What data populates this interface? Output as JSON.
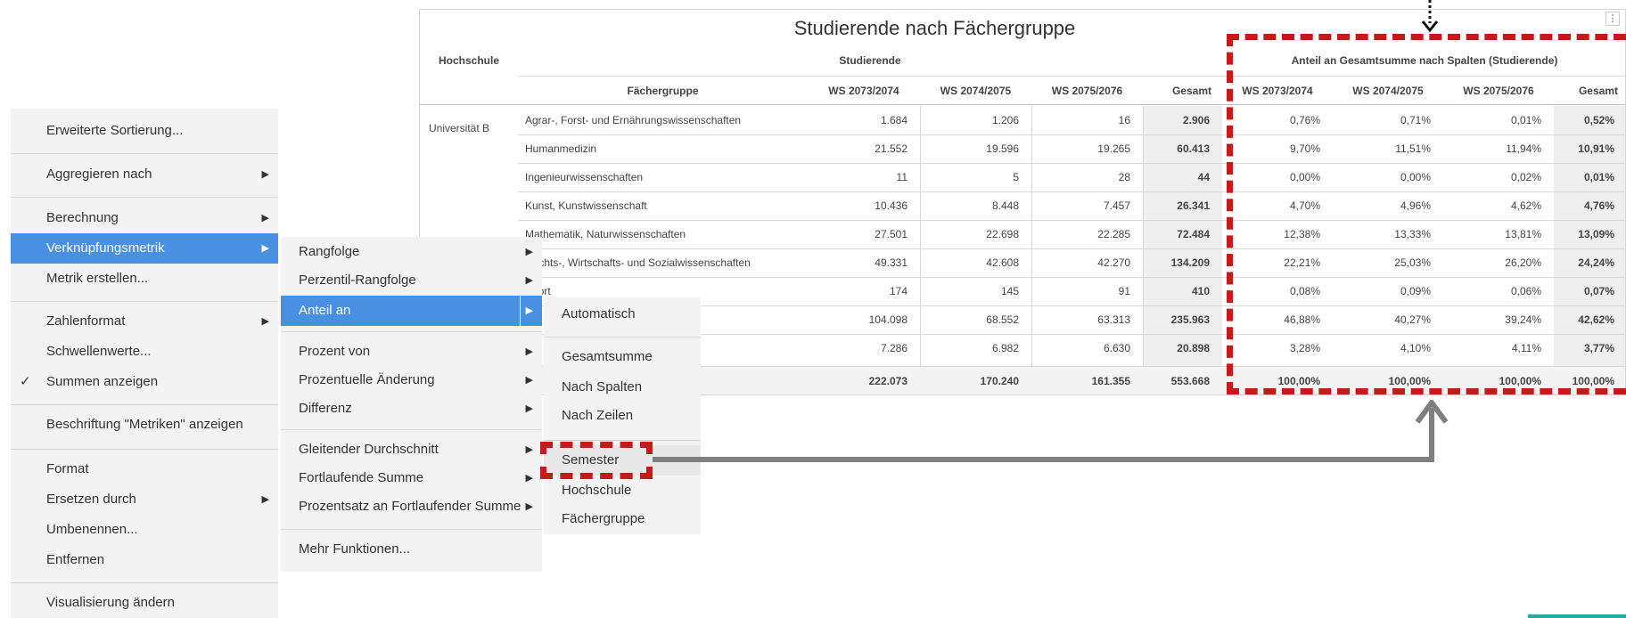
{
  "grid": {
    "title": "Studierende nach Fächergruppe",
    "more_glyph": "⋮",
    "headers": {
      "hochschule": "Hochschule",
      "studierende": "Studierende",
      "anteil": "Anteil an Gesamtsumme nach Spalten (Studierende)",
      "faechergruppe": "Fächergruppe",
      "cols": [
        "WS 2073/2074",
        "WS 2074/2075",
        "WS 2075/2076",
        "Gesamt",
        "WS 2073/2074",
        "WS 2074/2075",
        "WS 2075/2076",
        "Gesamt"
      ]
    },
    "hochschule_value": "Universität B",
    "rows": [
      {
        "fach": "Agrar-, Forst- und Ernährungswissenschaften",
        "vals": [
          "1.684",
          "1.206",
          "16",
          "2.906",
          "0,76%",
          "0,71%",
          "0,01%",
          "0,52%"
        ]
      },
      {
        "fach": "Humanmedizin",
        "vals": [
          "21.552",
          "19.596",
          "19.265",
          "60.413",
          "9,70%",
          "11,51%",
          "11,94%",
          "10,91%"
        ]
      },
      {
        "fach": "Ingenieurwissenschaften",
        "vals": [
          "11",
          "5",
          "28",
          "44",
          "0,00%",
          "0,00%",
          "0,02%",
          "0,01%"
        ]
      },
      {
        "fach": "Kunst, Kunstwissenschaft",
        "vals": [
          "10.436",
          "8.448",
          "7.457",
          "26.341",
          "4,70%",
          "4,96%",
          "4,62%",
          "4,76%"
        ]
      },
      {
        "fach": "Mathematik, Naturwissenschaften",
        "vals": [
          "27.501",
          "22.698",
          "22.285",
          "72.484",
          "12,38%",
          "13,33%",
          "13,81%",
          "13,09%"
        ]
      },
      {
        "fach": "Rechts-, Wirtschafts- und Sozialwissenschaften",
        "vals": [
          "49.331",
          "42.608",
          "42.270",
          "134.209",
          "22,21%",
          "25,03%",
          "26,20%",
          "24,24%"
        ]
      },
      {
        "fach": "Sport",
        "vals": [
          "174",
          "145",
          "91",
          "410",
          "0,08%",
          "0,09%",
          "0,06%",
          "0,07%"
        ]
      },
      {
        "fach": "",
        "vals": [
          "104.098",
          "68.552",
          "63.313",
          "235.963",
          "46,88%",
          "40,27%",
          "39,24%",
          "42,62%"
        ]
      },
      {
        "fach": "",
        "vals": [
          "7.286",
          "6.982",
          "6.630",
          "20.898",
          "3,28%",
          "4,10%",
          "4,11%",
          "3,77%"
        ]
      }
    ],
    "total": [
      "222.073",
      "170.240",
      "161.355",
      "553.668",
      "100,00%",
      "100,00%",
      "100,00%",
      "100,00%"
    ]
  },
  "menu1": {
    "items": [
      "Erweiterte Sortierung...",
      "Aggregieren nach",
      "Berechnung",
      "Verknüpfungsmetrik",
      "Metrik erstellen...",
      "Zahlenformat",
      "Schwellenwerte...",
      "Summen anzeigen",
      "Beschriftung \"Metriken\" anzeigen",
      "Format",
      "Ersetzen durch",
      "Umbenennen...",
      "Entfernen",
      "Visualisierung ändern"
    ],
    "check_glyph": "✓"
  },
  "menu2": {
    "items": [
      "Rangfolge",
      "Perzentil-Rangfolge",
      "Anteil an",
      "Prozent von",
      "Prozentuelle Änderung",
      "Differenz",
      "Gleitender Durchschnitt",
      "Fortlaufende Summe",
      "Prozentsatz an Fortlaufender Summe",
      "Mehr Funktionen..."
    ]
  },
  "menu3": {
    "items": [
      "Automatisch",
      "Gesamtsumme",
      "Nach Spalten",
      "Nach Zeilen",
      "Semester",
      "Hochschule",
      "Fächergruppe"
    ]
  },
  "submenu_arrow": "▶",
  "colors": {
    "menu_bg": "#f3f3f3",
    "selected": "#4a90e2",
    "annotation_red": "#c41a1a",
    "annotation_arrow": "#808080"
  }
}
